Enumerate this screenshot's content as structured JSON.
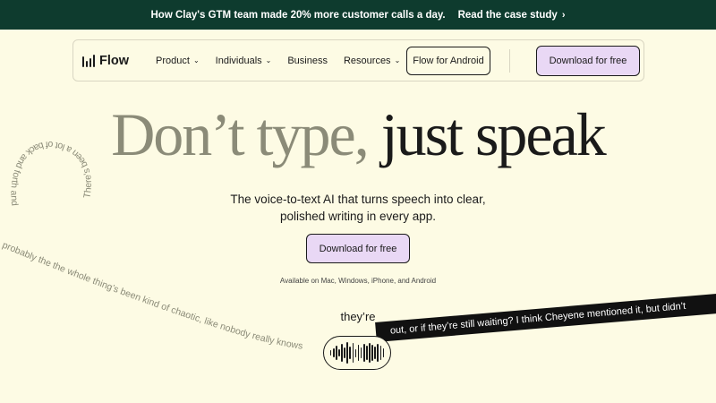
{
  "banner": {
    "text": "How Clay's GTM team made 20% more customer calls a day.",
    "cta": "Read the case study",
    "cta_icon": "chevron-right-icon"
  },
  "nav": {
    "logo_text": "Flow",
    "logo_icon": "waveform-bars-icon",
    "items": [
      {
        "label": "Product",
        "dropdown": true
      },
      {
        "label": "Individuals",
        "dropdown": true
      },
      {
        "label": "Business",
        "dropdown": false
      },
      {
        "label": "Resources",
        "dropdown": true
      }
    ],
    "android_button": "Flow for Android",
    "download_button": "Download for free"
  },
  "hero": {
    "headline_light": "Don’t type,",
    "headline_dark": "just speak",
    "subhead": "The voice-to-text AI that turns speech into clear, polished writing in every app.",
    "download_button": "Download for free",
    "availability": "Available on Mac, Windows, iPhone, and Android",
    "transcribed_word": "they’re"
  },
  "decorative_text": {
    "loop_text": "There’s been a lot of back and forth and honestly",
    "curve_text": "probably the the whole thing’s been kind of chaotic, like nobody really knows",
    "ribbon_text": "out, or if they’re still waiting? I think Cheyene mentioned it, but didn’t"
  },
  "colors": {
    "background": "#fdfbe4",
    "banner_bg": "#0e3b2e",
    "accent_button": "#e9d8f5",
    "headline_light": "#8b8b78",
    "text_dark": "#1a1a1a"
  }
}
